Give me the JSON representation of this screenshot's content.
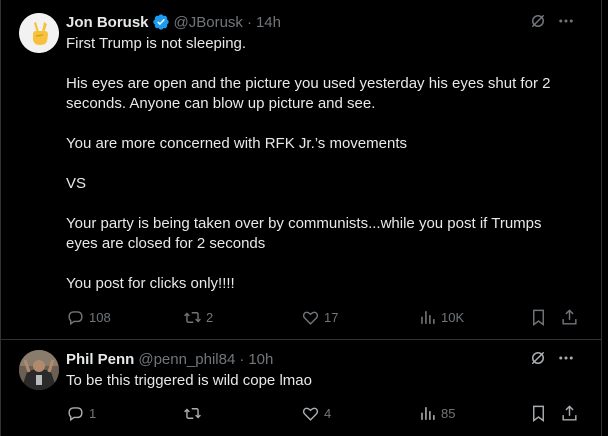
{
  "posts": [
    {
      "name": "Jon Borusk",
      "handle": "@JBorusk",
      "dot": "·",
      "time": "14h",
      "verified": true,
      "avatar_icon": "peace-hand-emoji",
      "paragraphs": [
        "First Trump is not sleeping.",
        "His eyes are open and the picture you used yesterday his eyes shut for 2 seconds. Anyone can blow up picture and see.",
        "You are more concerned with RFK Jr.’s movements",
        "VS",
        "Your party is being taken over by communists...while you post if Trumps eyes are closed for 2 seconds",
        "You post for clicks only!!!!"
      ],
      "metrics": {
        "replies": "108",
        "reposts": "2",
        "likes": "17",
        "views": "10K"
      }
    },
    {
      "name": "Phil Penn",
      "handle": "@penn_phil84",
      "dot": "·",
      "time": "10h",
      "verified": false,
      "avatar_icon": "person-photo",
      "paragraphs": [
        "To be this triggered is wild cope lmao"
      ],
      "metrics": {
        "replies": "1",
        "reposts": "",
        "likes": "4",
        "views": "85"
      }
    }
  ],
  "colors": {
    "background": "#000000",
    "text": "#e7e9ea",
    "muted": "#71767b",
    "verified": "#1d9bf0",
    "border": "#2f3336"
  }
}
